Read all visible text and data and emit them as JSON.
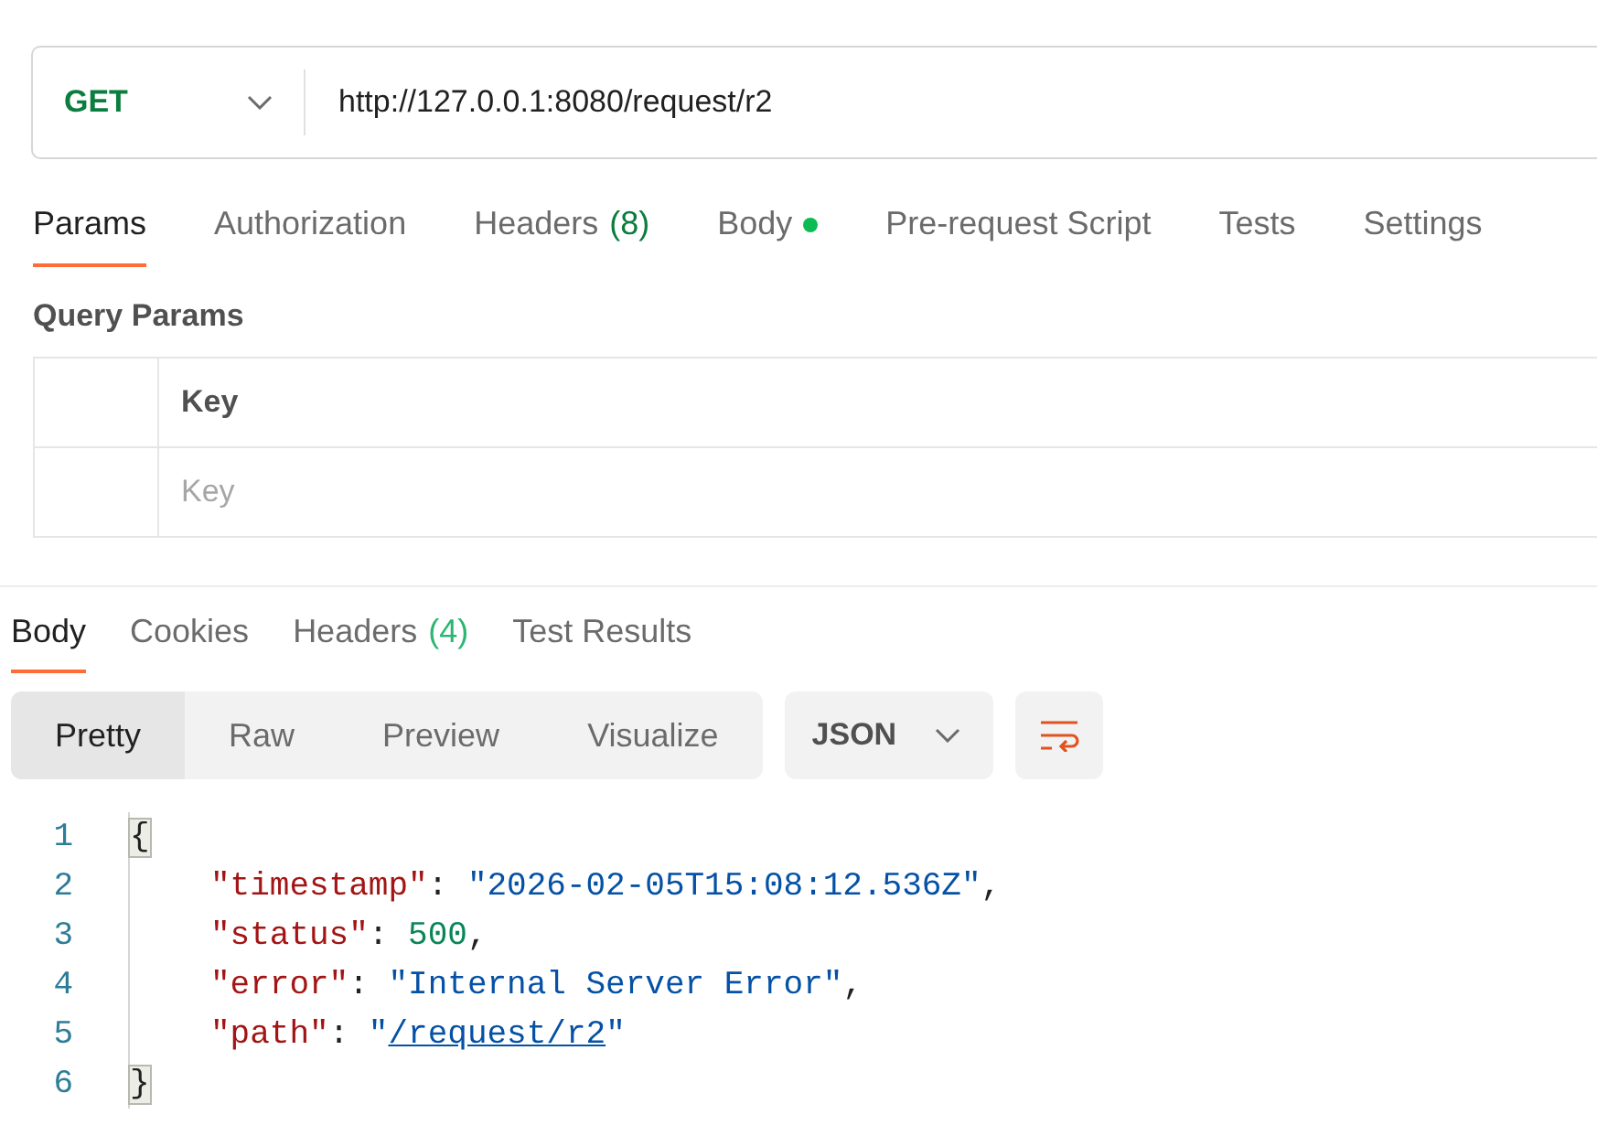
{
  "request": {
    "method": "GET",
    "url": "http://127.0.0.1:8080/request/r2"
  },
  "request_tabs": [
    {
      "label": "Params",
      "dot": false,
      "selected": true
    },
    {
      "label": "Authorization",
      "dot": false,
      "selected": false
    },
    {
      "label": "Headers",
      "count": "(8)",
      "dot": false,
      "selected": false
    },
    {
      "label": "Body",
      "dot": true,
      "selected": false
    },
    {
      "label": "Pre-request Script",
      "dot": false,
      "selected": false
    },
    {
      "label": "Tests",
      "dot": false,
      "selected": false
    },
    {
      "label": "Settings",
      "dot": false,
      "selected": false
    }
  ],
  "query_params": {
    "title": "Query Params",
    "header": "Key",
    "placeholder": "Key"
  },
  "response_tabs": [
    {
      "label": "Body",
      "selected": true
    },
    {
      "label": "Cookies",
      "selected": false
    },
    {
      "label": "Headers",
      "count": "(4)",
      "selected": false
    },
    {
      "label": "Test Results",
      "selected": false
    }
  ],
  "view_modes": [
    {
      "label": "Pretty",
      "selected": true
    },
    {
      "label": "Raw",
      "selected": false
    },
    {
      "label": "Preview",
      "selected": false
    },
    {
      "label": "Visualize",
      "selected": false
    }
  ],
  "format": "JSON",
  "code_lines": [
    {
      "number": "1",
      "kind": "brace",
      "tokens": [
        {
          "kind": "brace",
          "text": "{"
        }
      ]
    },
    {
      "number": "2",
      "kind": "member",
      "tokens": [
        {
          "kind": "key",
          "text": "\"timestamp\""
        },
        {
          "kind": "punct",
          "text": ": "
        },
        {
          "kind": "string",
          "text": "\"2026-02-05T15:08:12.536Z\""
        },
        {
          "kind": "punct",
          "text": ","
        }
      ]
    },
    {
      "number": "3",
      "kind": "member",
      "tokens": [
        {
          "kind": "key",
          "text": "\"status\""
        },
        {
          "kind": "punct",
          "text": ": "
        },
        {
          "kind": "number",
          "text": "500"
        },
        {
          "kind": "punct",
          "text": ","
        }
      ]
    },
    {
      "number": "4",
      "kind": "member",
      "tokens": [
        {
          "kind": "key",
          "text": "\"error\""
        },
        {
          "kind": "punct",
          "text": ": "
        },
        {
          "kind": "string",
          "text": "\"Internal Server Error\""
        },
        {
          "kind": "punct",
          "text": ","
        }
      ]
    },
    {
      "number": "5",
      "kind": "member",
      "tokens": [
        {
          "kind": "key",
          "text": "\"path\""
        },
        {
          "kind": "punct",
          "text": ": "
        },
        {
          "kind": "string",
          "text": "\""
        },
        {
          "kind": "link",
          "text": "/request/r2"
        },
        {
          "kind": "string",
          "text": "\""
        }
      ]
    },
    {
      "number": "6",
      "kind": "brace",
      "tokens": [
        {
          "kind": "brace",
          "text": "}"
        }
      ]
    }
  ]
}
